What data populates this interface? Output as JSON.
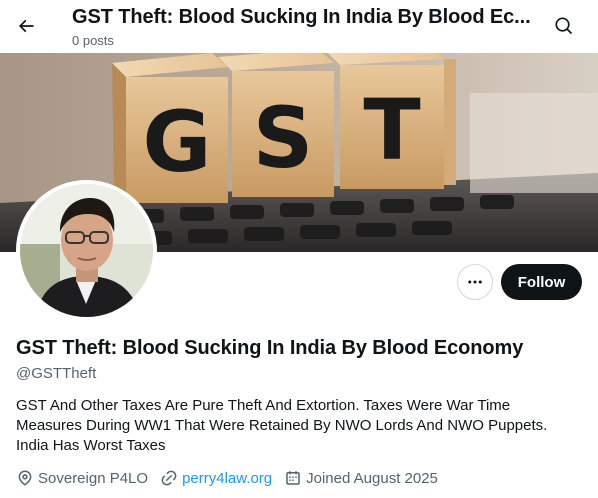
{
  "header": {
    "title": "GST Theft: Blood Sucking In India By Blood Ec...",
    "posts_count": "0 posts"
  },
  "banner": {
    "letters": [
      "G",
      "S",
      "T"
    ]
  },
  "actions": {
    "follow_label": "Follow"
  },
  "profile": {
    "display_name": "GST Theft: Blood Sucking In India By Blood Economy",
    "handle": "@GSTTheft",
    "bio": "GST And Other Taxes Are Pure Theft And Extortion. Taxes Were War Time Measures During WW1 That Were Retained By NWO Lords And NWO Puppets. India Has Worst Taxes",
    "location": "Sovereign P4LO",
    "website": "perry4law.org",
    "joined": "Joined August 2025"
  },
  "colors": {
    "text": "#0f1419",
    "secondary": "#536471",
    "link": "#1d9bf0",
    "follow_bg": "#0f1419"
  },
  "icons": [
    "back-arrow-icon",
    "search-icon",
    "more-icon",
    "location-icon",
    "link-icon",
    "calendar-icon"
  ]
}
